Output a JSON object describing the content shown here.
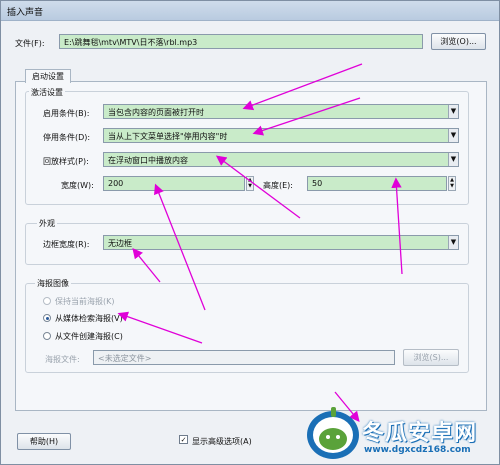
{
  "window": {
    "title": "插入声音"
  },
  "file": {
    "label": "文件(F):",
    "value": "E:\\跳舞毯\\mtv\\MTV\\日不落\\rbl.mp3",
    "browse_label": "浏览(O)..."
  },
  "tabs": [
    {
      "label": "启动设置"
    }
  ],
  "activation": {
    "group_title": "激活设置",
    "enable_label": "启用条件(B):",
    "enable_value": "当包含内容的页面被打开时",
    "disable_label": "停用条件(D):",
    "disable_value": "当从上下文菜单选择\"停用内容\"时",
    "playback_label": "回放样式(P):",
    "playback_value": "在浮动窗口中播放内容",
    "width_label": "宽度(W):",
    "width_value": "200",
    "height_label": "高度(E):",
    "height_value": "50"
  },
  "appearance": {
    "group_title": "外观",
    "border_label": "边框宽度(R):",
    "border_value": "无边框"
  },
  "poster": {
    "group_title": "海报图像",
    "options": [
      {
        "label": "保持当前海报(K)",
        "selected": false,
        "enabled": false
      },
      {
        "label": "从媒体检索海报(V)",
        "selected": true,
        "enabled": true
      },
      {
        "label": "从文件创建海报(C)",
        "selected": false,
        "enabled": true
      }
    ],
    "file_label": "海报文件:",
    "file_placeholder": "<未选定文件>",
    "browse_label": "浏览(S)..."
  },
  "footer": {
    "help_label": "帮助(H)",
    "advanced_label": "显示高级选项(A)",
    "advanced_checked": true
  },
  "watermark": {
    "name": "冬瓜安卓网",
    "url": "www.dgxcdz168.com"
  },
  "colors": {
    "field_bg": "#c9ebc9",
    "arrow": "#e000d8",
    "watermark_blue": "#1a6fb6"
  }
}
